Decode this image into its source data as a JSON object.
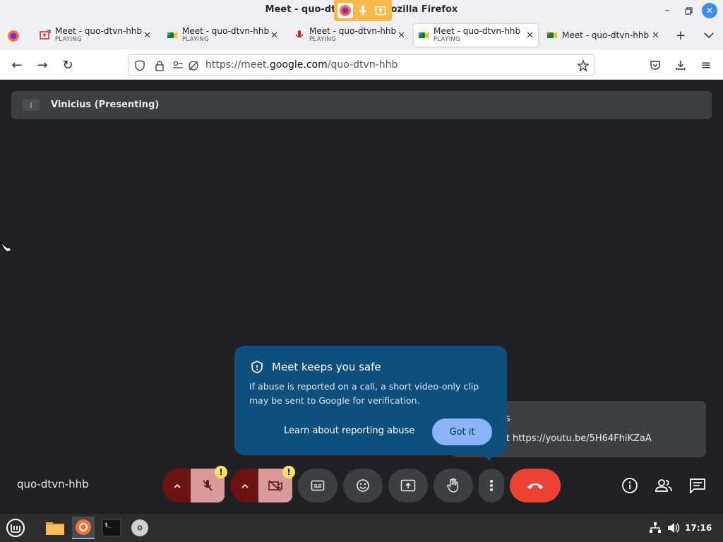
{
  "window": {
    "title": "Meet - quo-dtvn-hhb - Mozilla Firefox"
  },
  "tabs": [
    {
      "title": "Meet - quo-dtvn-hhb",
      "status": "PLAYING"
    },
    {
      "title": "Meet - quo-dtvn-hhb",
      "status": "PLAYING"
    },
    {
      "title": "Meet - quo-dtvn-hhb",
      "status": "PLAYING"
    },
    {
      "title": "Meet - quo-dtvn-hhb",
      "status": "PLAYING"
    },
    {
      "title": "Meet - quo-dtvn-hhb",
      "status": ""
    }
  ],
  "urlbar": {
    "url_prefix": "https://meet.",
    "url_domain": "google.com",
    "url_path": "/quo-dtvn-hhb"
  },
  "meet": {
    "presenter_label": "Vinicius (Presenting)",
    "meeting_code": "quo-dtvn-hhb",
    "chat_toast": {
      "sender": "ius",
      "message": "tyt https://youtu.be/5H64FhiKZaA"
    },
    "safety_popup": {
      "title": "Meet keeps you safe",
      "body": "If abuse is reported on a call, a short video-only clip may be sent to Google for verification.",
      "learn_link": "Learn about reporting abuse",
      "got_it": "Got it"
    },
    "warn_badge": "!"
  },
  "taskbar": {
    "clock": "17:16"
  },
  "colors": {
    "accent": "#8ab4f8",
    "hangup": "#ea4335",
    "popup": "#0e4f7d",
    "meet_bg": "#202124"
  }
}
